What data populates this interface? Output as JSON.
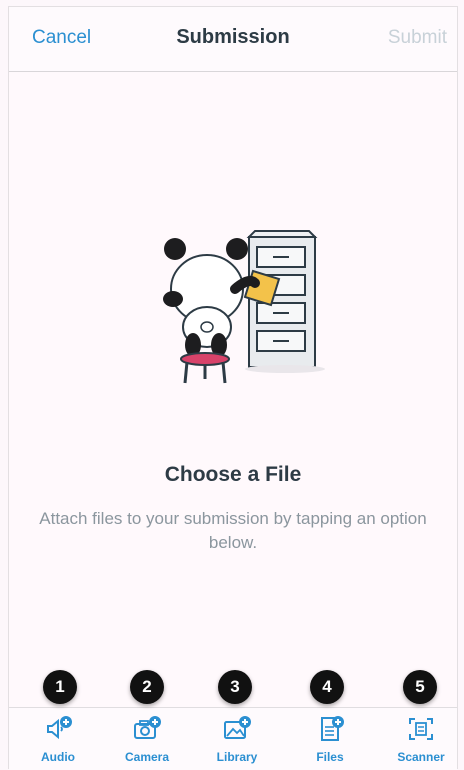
{
  "navbar": {
    "cancel_label": "Cancel",
    "title": "Submission",
    "submit_label": "Submit"
  },
  "empty_state": {
    "title": "Choose a File",
    "message": "Attach files to your submission by tapping an option below."
  },
  "tabs": [
    {
      "label": "Audio",
      "icon": "audio-add-icon",
      "badge": "1"
    },
    {
      "label": "Camera",
      "icon": "camera-add-icon",
      "badge": "2"
    },
    {
      "label": "Library",
      "icon": "library-add-icon",
      "badge": "3"
    },
    {
      "label": "Files",
      "icon": "files-add-icon",
      "badge": "4"
    },
    {
      "label": "Scanner",
      "icon": "scanner-icon",
      "badge": "5"
    }
  ],
  "colors": {
    "accent": "#2b8fd1",
    "disabled": "#c8d1d8",
    "text": "#2d3b45",
    "muted": "#8b969e"
  }
}
